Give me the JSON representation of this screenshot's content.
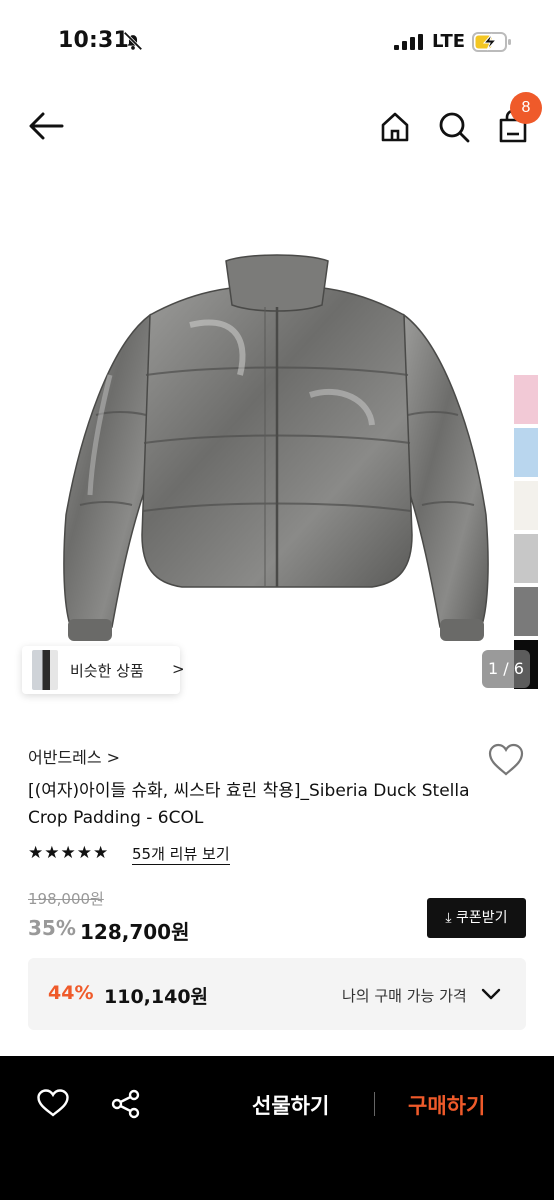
{
  "status_bar": {
    "time": "10:31",
    "network": "LTE"
  },
  "nav": {
    "cart_count": "8"
  },
  "gallery": {
    "counter": "1 / 6",
    "similar_label": "비슷한 상품",
    "similar_chevron": ">",
    "swatch_colors": [
      "#f2c9d6",
      "#b9d6ee",
      "#f3f1ec",
      "#c7c7c7",
      "#7a7a7a",
      "#0b0b0b"
    ]
  },
  "product": {
    "brand": "어반드레스 >",
    "title": "[(여자)아이들 슈화, 씨스타 효린 착용]_Siberia Duck Stella Crop Padding - 6COL",
    "stars": "★★★★★",
    "review_link": "55개 리뷰 보기"
  },
  "price": {
    "original": "198,000원",
    "discount_rate": "35%",
    "sale": "128,700원",
    "coupon_button": "⤓ 쿠폰받기"
  },
  "best_price": {
    "rate": "44%",
    "price": "110,140원",
    "label": "나의 구매 가능 가격"
  },
  "bottom_bar": {
    "gift_button": "선물하기",
    "buy_button": "구매하기"
  },
  "colors": {
    "accent": "#ef5a2a",
    "black": "#000000"
  }
}
